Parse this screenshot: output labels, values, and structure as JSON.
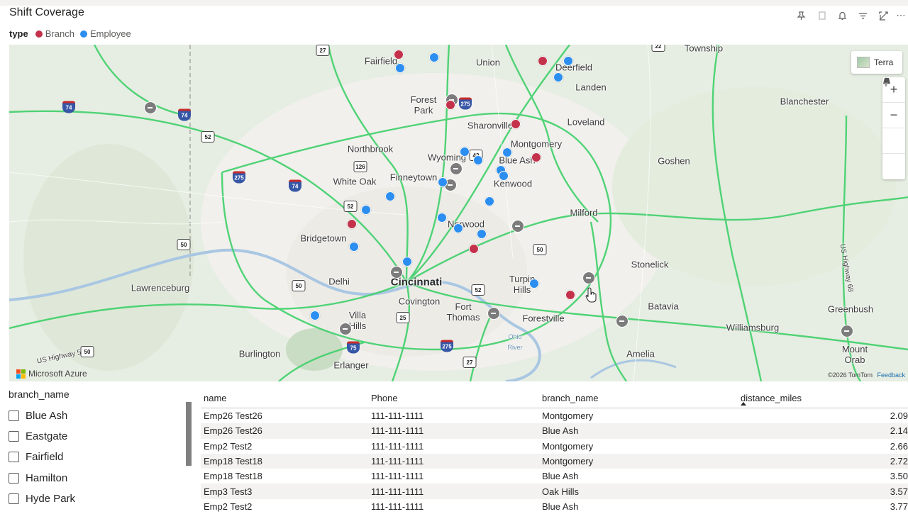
{
  "title": "Shift Coverage",
  "toolbar": {
    "icons": [
      "pin-icon",
      "copy-icon",
      "bell-icon",
      "filter-icon",
      "expand-icon",
      "more-icon"
    ]
  },
  "legend": {
    "title": "type",
    "items": [
      {
        "label": "Branch",
        "color": "#c4314b"
      },
      {
        "label": "Employee",
        "color": "#2b8ef0"
      }
    ]
  },
  "map": {
    "style_button": "Terra",
    "zoom_in": "+",
    "zoom_out": "−",
    "brand": "Microsoft Azure",
    "attribution": "©2026 TomTom",
    "feedback": "Feedback",
    "places": [
      "Township",
      "Fairfield",
      "Union",
      "Deerfield",
      "Landen",
      "Forest Park",
      "Sharonville",
      "Loveland",
      "Blanchester",
      "Northbrook",
      "Wyoming",
      "Montgomery",
      "Blue Ash",
      "Goshen",
      "White Oak",
      "Finneytown",
      "Kenwood",
      "Milford",
      "Bridgetown",
      "Norwood",
      "Stonelick",
      "Lawrenceburg",
      "Delhi",
      "Cincinnati",
      "Covington",
      "Turpin Hills",
      "Fort Thomas",
      "Batavia",
      "Villa Hills",
      "Forestville",
      "Greenbush",
      "Williamsburg",
      "Burlington",
      "Erlanger",
      "Amelia",
      "Mount Orab",
      "Ohio River",
      "US Highway 68",
      "US Highway 50"
    ],
    "shields": [
      "27",
      "22",
      "74",
      "74",
      "52",
      "275",
      "126",
      "42",
      "275",
      "74",
      "52",
      "50",
      "52",
      "50",
      "50",
      "25",
      "75",
      "275",
      "27",
      "50"
    ]
  },
  "slicer": {
    "title": "branch_name",
    "items": [
      "Blue Ash",
      "Eastgate",
      "Fairfield",
      "Hamilton",
      "Hyde Park"
    ]
  },
  "table": {
    "headers": [
      "name",
      "Phone",
      "branch_name",
      "distance_miles"
    ],
    "rows": [
      [
        "Emp26 Test26",
        "111-111-1111",
        "Montgomery",
        "2.09"
      ],
      [
        "Emp26 Test26",
        "111-111-1111",
        "Blue Ash",
        "2.14"
      ],
      [
        "Emp2 Test2",
        "111-111-1111",
        "Montgomery",
        "2.66"
      ],
      [
        "Emp18 Test18",
        "111-111-1111",
        "Montgomery",
        "2.72"
      ],
      [
        "Emp18 Test18",
        "111-111-1111",
        "Blue Ash",
        "3.50"
      ],
      [
        "Emp3 Test3",
        "111-111-1111",
        "Oak Hills",
        "3.57"
      ],
      [
        "Emp2 Test2",
        "111-111-1111",
        "Blue Ash",
        "3.77"
      ]
    ]
  }
}
